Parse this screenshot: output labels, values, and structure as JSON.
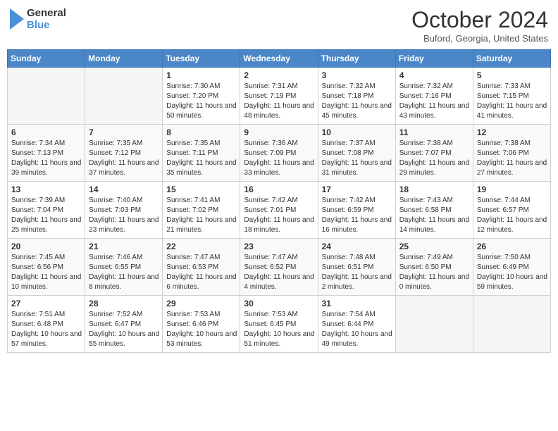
{
  "header": {
    "logo_line1": "General",
    "logo_line2": "Blue",
    "month_title": "October 2024",
    "location": "Buford, Georgia, United States"
  },
  "days_of_week": [
    "Sunday",
    "Monday",
    "Tuesday",
    "Wednesday",
    "Thursday",
    "Friday",
    "Saturday"
  ],
  "weeks": [
    [
      {
        "num": "",
        "sunrise": "",
        "sunset": "",
        "daylight": "",
        "empty": true
      },
      {
        "num": "",
        "sunrise": "",
        "sunset": "",
        "daylight": "",
        "empty": true
      },
      {
        "num": "1",
        "sunrise": "Sunrise: 7:30 AM",
        "sunset": "Sunset: 7:20 PM",
        "daylight": "Daylight: 11 hours and 50 minutes.",
        "empty": false
      },
      {
        "num": "2",
        "sunrise": "Sunrise: 7:31 AM",
        "sunset": "Sunset: 7:19 PM",
        "daylight": "Daylight: 11 hours and 48 minutes.",
        "empty": false
      },
      {
        "num": "3",
        "sunrise": "Sunrise: 7:32 AM",
        "sunset": "Sunset: 7:18 PM",
        "daylight": "Daylight: 11 hours and 45 minutes.",
        "empty": false
      },
      {
        "num": "4",
        "sunrise": "Sunrise: 7:32 AM",
        "sunset": "Sunset: 7:16 PM",
        "daylight": "Daylight: 11 hours and 43 minutes.",
        "empty": false
      },
      {
        "num": "5",
        "sunrise": "Sunrise: 7:33 AM",
        "sunset": "Sunset: 7:15 PM",
        "daylight": "Daylight: 11 hours and 41 minutes.",
        "empty": false
      }
    ],
    [
      {
        "num": "6",
        "sunrise": "Sunrise: 7:34 AM",
        "sunset": "Sunset: 7:13 PM",
        "daylight": "Daylight: 11 hours and 39 minutes.",
        "empty": false
      },
      {
        "num": "7",
        "sunrise": "Sunrise: 7:35 AM",
        "sunset": "Sunset: 7:12 PM",
        "daylight": "Daylight: 11 hours and 37 minutes.",
        "empty": false
      },
      {
        "num": "8",
        "sunrise": "Sunrise: 7:35 AM",
        "sunset": "Sunset: 7:11 PM",
        "daylight": "Daylight: 11 hours and 35 minutes.",
        "empty": false
      },
      {
        "num": "9",
        "sunrise": "Sunrise: 7:36 AM",
        "sunset": "Sunset: 7:09 PM",
        "daylight": "Daylight: 11 hours and 33 minutes.",
        "empty": false
      },
      {
        "num": "10",
        "sunrise": "Sunrise: 7:37 AM",
        "sunset": "Sunset: 7:08 PM",
        "daylight": "Daylight: 11 hours and 31 minutes.",
        "empty": false
      },
      {
        "num": "11",
        "sunrise": "Sunrise: 7:38 AM",
        "sunset": "Sunset: 7:07 PM",
        "daylight": "Daylight: 11 hours and 29 minutes.",
        "empty": false
      },
      {
        "num": "12",
        "sunrise": "Sunrise: 7:38 AM",
        "sunset": "Sunset: 7:06 PM",
        "daylight": "Daylight: 11 hours and 27 minutes.",
        "empty": false
      }
    ],
    [
      {
        "num": "13",
        "sunrise": "Sunrise: 7:39 AM",
        "sunset": "Sunset: 7:04 PM",
        "daylight": "Daylight: 11 hours and 25 minutes.",
        "empty": false
      },
      {
        "num": "14",
        "sunrise": "Sunrise: 7:40 AM",
        "sunset": "Sunset: 7:03 PM",
        "daylight": "Daylight: 11 hours and 23 minutes.",
        "empty": false
      },
      {
        "num": "15",
        "sunrise": "Sunrise: 7:41 AM",
        "sunset": "Sunset: 7:02 PM",
        "daylight": "Daylight: 11 hours and 21 minutes.",
        "empty": false
      },
      {
        "num": "16",
        "sunrise": "Sunrise: 7:42 AM",
        "sunset": "Sunset: 7:01 PM",
        "daylight": "Daylight: 11 hours and 18 minutes.",
        "empty": false
      },
      {
        "num": "17",
        "sunrise": "Sunrise: 7:42 AM",
        "sunset": "Sunset: 6:59 PM",
        "daylight": "Daylight: 11 hours and 16 minutes.",
        "empty": false
      },
      {
        "num": "18",
        "sunrise": "Sunrise: 7:43 AM",
        "sunset": "Sunset: 6:58 PM",
        "daylight": "Daylight: 11 hours and 14 minutes.",
        "empty": false
      },
      {
        "num": "19",
        "sunrise": "Sunrise: 7:44 AM",
        "sunset": "Sunset: 6:57 PM",
        "daylight": "Daylight: 11 hours and 12 minutes.",
        "empty": false
      }
    ],
    [
      {
        "num": "20",
        "sunrise": "Sunrise: 7:45 AM",
        "sunset": "Sunset: 6:56 PM",
        "daylight": "Daylight: 11 hours and 10 minutes.",
        "empty": false
      },
      {
        "num": "21",
        "sunrise": "Sunrise: 7:46 AM",
        "sunset": "Sunset: 6:55 PM",
        "daylight": "Daylight: 11 hours and 8 minutes.",
        "empty": false
      },
      {
        "num": "22",
        "sunrise": "Sunrise: 7:47 AM",
        "sunset": "Sunset: 6:53 PM",
        "daylight": "Daylight: 11 hours and 6 minutes.",
        "empty": false
      },
      {
        "num": "23",
        "sunrise": "Sunrise: 7:47 AM",
        "sunset": "Sunset: 6:52 PM",
        "daylight": "Daylight: 11 hours and 4 minutes.",
        "empty": false
      },
      {
        "num": "24",
        "sunrise": "Sunrise: 7:48 AM",
        "sunset": "Sunset: 6:51 PM",
        "daylight": "Daylight: 11 hours and 2 minutes.",
        "empty": false
      },
      {
        "num": "25",
        "sunrise": "Sunrise: 7:49 AM",
        "sunset": "Sunset: 6:50 PM",
        "daylight": "Daylight: 11 hours and 0 minutes.",
        "empty": false
      },
      {
        "num": "26",
        "sunrise": "Sunrise: 7:50 AM",
        "sunset": "Sunset: 6:49 PM",
        "daylight": "Daylight: 10 hours and 59 minutes.",
        "empty": false
      }
    ],
    [
      {
        "num": "27",
        "sunrise": "Sunrise: 7:51 AM",
        "sunset": "Sunset: 6:48 PM",
        "daylight": "Daylight: 10 hours and 57 minutes.",
        "empty": false
      },
      {
        "num": "28",
        "sunrise": "Sunrise: 7:52 AM",
        "sunset": "Sunset: 6:47 PM",
        "daylight": "Daylight: 10 hours and 55 minutes.",
        "empty": false
      },
      {
        "num": "29",
        "sunrise": "Sunrise: 7:53 AM",
        "sunset": "Sunset: 6:46 PM",
        "daylight": "Daylight: 10 hours and 53 minutes.",
        "empty": false
      },
      {
        "num": "30",
        "sunrise": "Sunrise: 7:53 AM",
        "sunset": "Sunset: 6:45 PM",
        "daylight": "Daylight: 10 hours and 51 minutes.",
        "empty": false
      },
      {
        "num": "31",
        "sunrise": "Sunrise: 7:54 AM",
        "sunset": "Sunset: 6:44 PM",
        "daylight": "Daylight: 10 hours and 49 minutes.",
        "empty": false
      },
      {
        "num": "",
        "sunrise": "",
        "sunset": "",
        "daylight": "",
        "empty": true
      },
      {
        "num": "",
        "sunrise": "",
        "sunset": "",
        "daylight": "",
        "empty": true
      }
    ]
  ]
}
